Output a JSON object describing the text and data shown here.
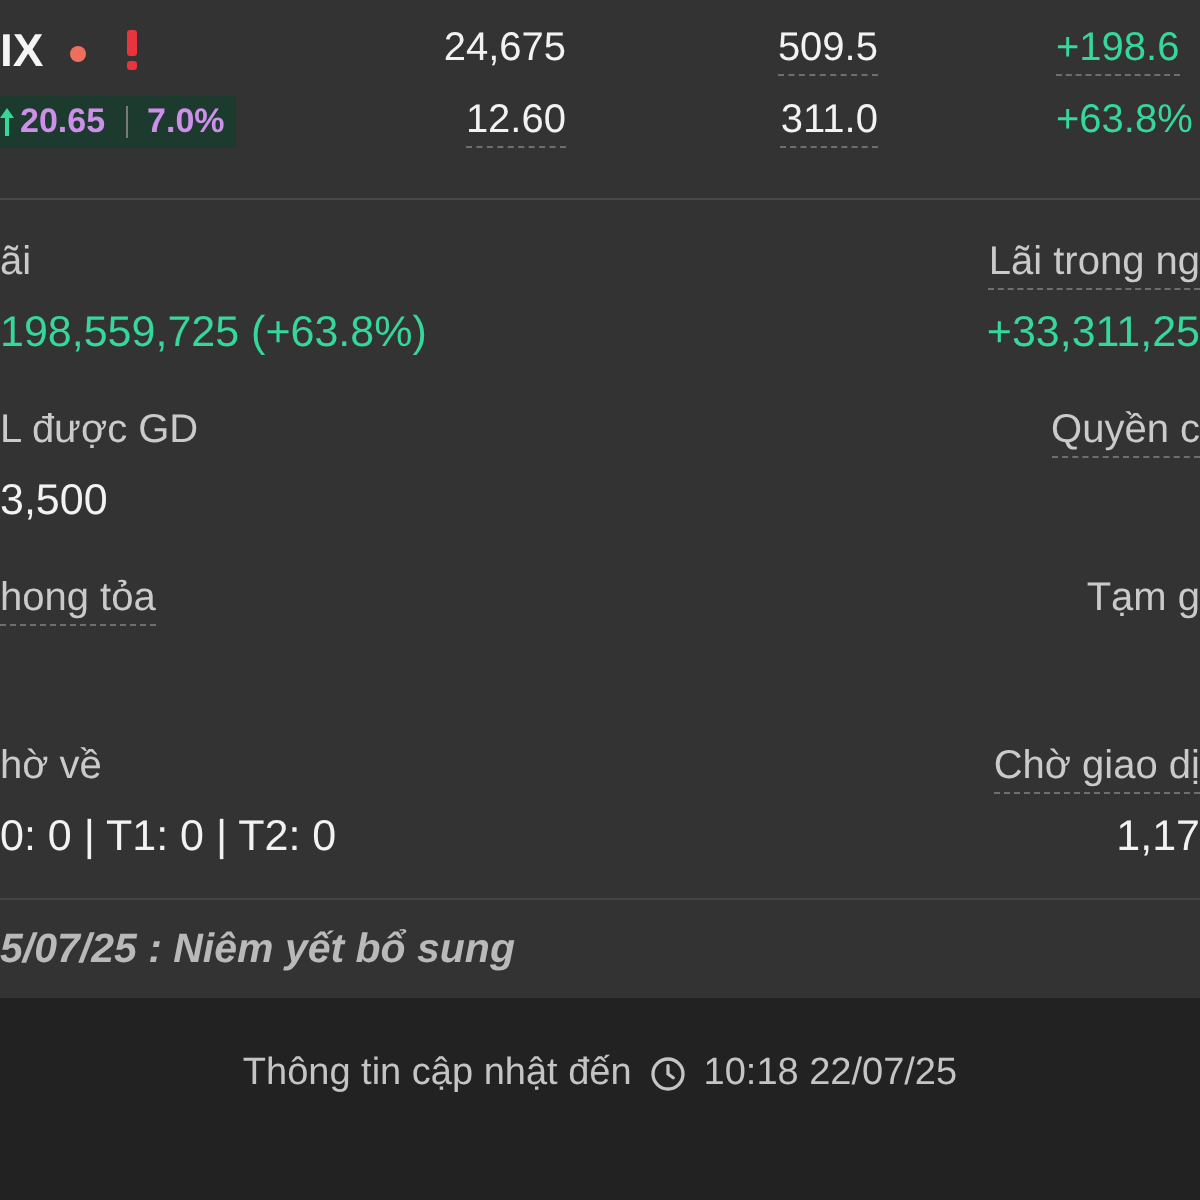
{
  "position": {
    "ticker": "IX",
    "rising": true,
    "change": "20.65",
    "change_percent": "7.0%",
    "columns": [
      {
        "top": {
          "text": "24,675",
          "kind": "plain",
          "underlined": false
        },
        "bottom": {
          "text": "12.60",
          "kind": "plain",
          "underlined": true
        }
      },
      {
        "top": {
          "text": "509.5",
          "kind": "plain",
          "underlined": true
        },
        "bottom": {
          "text": "311.0",
          "kind": "plain",
          "underlined": true
        }
      },
      {
        "top": {
          "text": "+198.6",
          "kind": "gain",
          "underlined": true
        },
        "bottom": {
          "text": "+63.8%",
          "kind": "gain",
          "underlined": false
        }
      }
    ]
  },
  "details": [
    {
      "left": {
        "label": "ãi",
        "label_underlined": false,
        "value": "198,559,725 (+63.8%)",
        "kind": "gain"
      },
      "right": {
        "label": "Lãi trong ng",
        "label_underlined": true,
        "value": "+33,311,25",
        "kind": "gain"
      }
    },
    {
      "left": {
        "label": "L được GD",
        "label_underlined": false,
        "value": "3,500",
        "kind": "plain"
      },
      "right": {
        "label": "Quyền c",
        "label_underlined": true
      }
    },
    {
      "left": {
        "label": "hong tỏa",
        "label_underlined": true
      },
      "right": {
        "label": "Tạm g",
        "label_underlined": false
      }
    },
    {
      "left": {
        "label": "hờ về",
        "label_underlined": false,
        "value": "0: 0 | T1: 0 | T2: 0",
        "kind": "plain"
      },
      "right": {
        "label": "Chờ giao dị",
        "label_underlined": true,
        "value": "1,17",
        "kind": "plain"
      }
    }
  ],
  "note": "5/07/25 : Niêm yết bổ sung",
  "footer": {
    "label": "Thông tin cập nhật đến",
    "time": "10:18 22/07/25"
  }
}
